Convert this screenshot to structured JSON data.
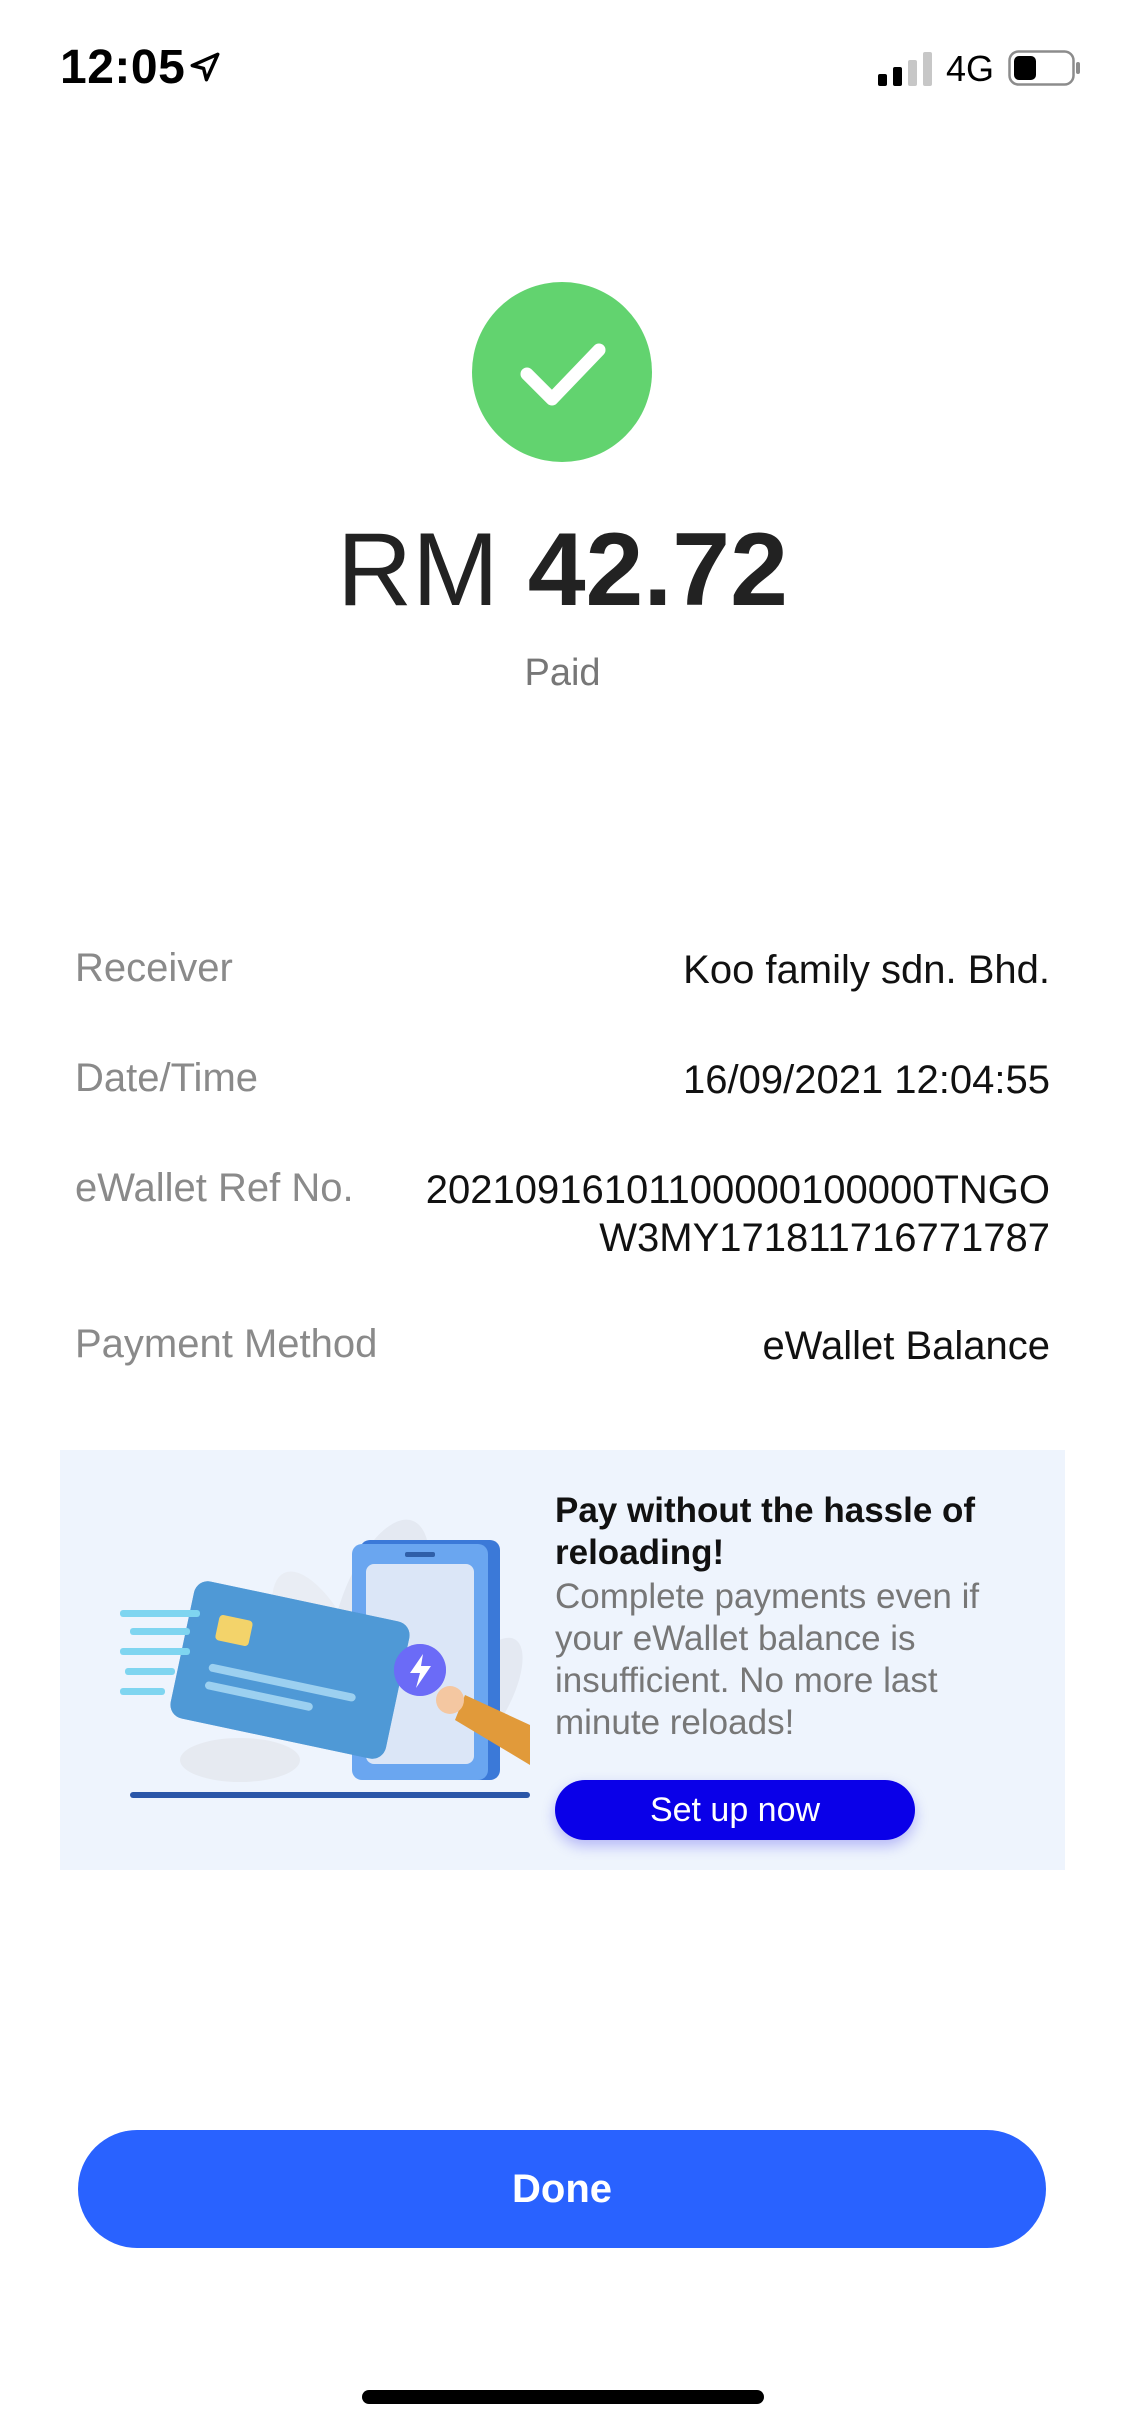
{
  "status_bar": {
    "time": "12:05",
    "network": "4G"
  },
  "payment": {
    "currency": "RM",
    "amount": "42.72",
    "status": "Paid"
  },
  "details": [
    {
      "label": "Receiver",
      "value": "Koo family sdn. Bhd."
    },
    {
      "label": "Date/Time",
      "value": "16/09/2021 12:04:55"
    },
    {
      "label": "eWallet Ref No.",
      "value": "20210916101100000100000TNGOW3MY171811716771787"
    },
    {
      "label": "Payment Method",
      "value": "eWallet Balance"
    }
  ],
  "promo": {
    "title": "Pay without the hassle of reloading!",
    "body": "Complete payments even if your eWallet balance is insufficient. No more last minute reloads!",
    "button_label": "Set up now"
  },
  "done_label": "Done",
  "colors": {
    "success_green": "#62d36f",
    "promo_button": "#0a00e8",
    "done_button": "#2962ff",
    "promo_bg": "#eef4fd"
  }
}
